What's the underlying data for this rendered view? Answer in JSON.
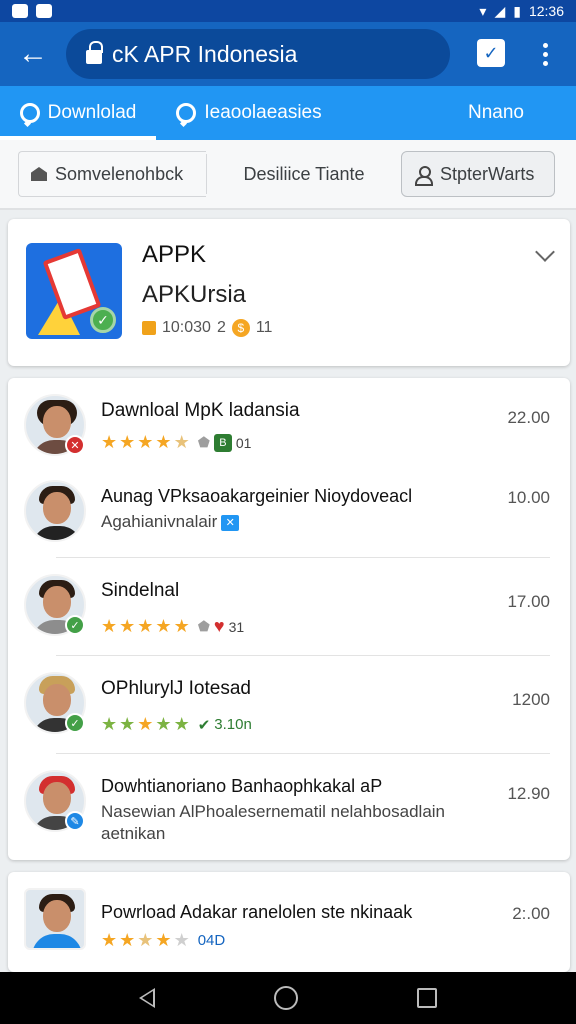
{
  "status_bar": {
    "time": "12:36"
  },
  "app_bar": {
    "url_text": "cK APR Indonesia"
  },
  "tabs": [
    {
      "label": "Downlolad"
    },
    {
      "label": "Ieaoolaeasies"
    },
    {
      "label": "Nnano"
    }
  ],
  "filters": [
    {
      "label": "Somvelenohbck"
    },
    {
      "label": "Desiliice Tiante"
    },
    {
      "label": "StpterWarts"
    }
  ],
  "app_card": {
    "title": "APPK",
    "subtitle": "APKUrsia",
    "meta_a": "10:030",
    "meta_b": "2",
    "meta_c": "11"
  },
  "list": [
    {
      "title": "Dawnloal MpK ladansia",
      "number": "22.00",
      "stars": 4.5,
      "tag": "01",
      "badge_color": "#d32f2f"
    },
    {
      "title": "Aunag VPksaoakargeinier Nioydoveacl",
      "subtitle": "Agahianivnalair",
      "number": "10.00",
      "badge_color": ""
    },
    {
      "title": "Sindelnal",
      "number": "17.00",
      "stars": 5,
      "tag": "31",
      "badge_color": "#43a047"
    },
    {
      "title": "OPhlurylJ Iotesad",
      "number": "1200",
      "stars": 5,
      "tag": "3.10n",
      "badge_color": "#43a047"
    },
    {
      "title": "Dowhtianoriano Banhaophkakal aP",
      "subtitle": "Nasewian AlPhoalesernematil nelahbosadlain",
      "subtitle2": "aetnikan",
      "number": "12.90",
      "badge_color": "#1e88e5"
    }
  ],
  "last_item": {
    "title": "Powrload Adakar ranelolen ste nkinaak",
    "number": "2:.00",
    "stars": 3.5,
    "tag": "04D"
  },
  "colors": {
    "primary": "#1565c0",
    "tab_bar": "#2196f3",
    "star": "#f5a623"
  },
  "icons": [
    "back-arrow-icon",
    "lock-icon",
    "edit-icon",
    "more-icon",
    "download-tab-icon",
    "explore-tab-icon",
    "house-icon",
    "person-icon",
    "chevron-down-icon",
    "nav-back-icon",
    "nav-home-icon",
    "nav-recents-icon"
  ]
}
